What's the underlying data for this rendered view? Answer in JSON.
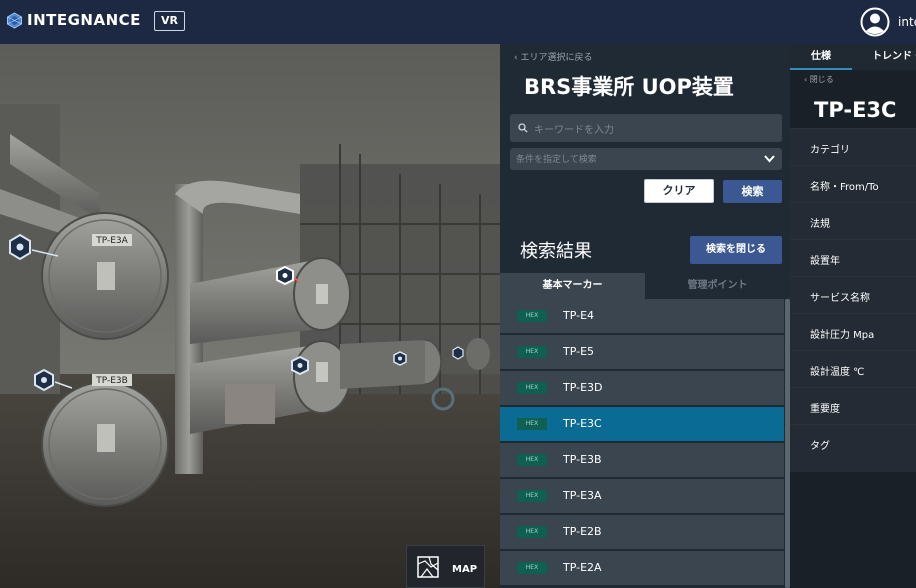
{
  "header": {
    "brand": "INTEGNANCE",
    "vr_label": "VR",
    "user_name": "inte"
  },
  "viewer": {
    "tag_labels": [
      "TP-E3A",
      "TP-E3B"
    ],
    "map_label": "MAP"
  },
  "search_panel": {
    "back_label": "エリア選択に戻る",
    "title": "BRS事業所 UOP装置",
    "keyword_placeholder": "キーワードを入力",
    "condition_placeholder": "条件を指定して検索",
    "clear_label": "クリア",
    "search_label": "検索",
    "results_title": "検索結果",
    "close_results_label": "検索を閉じる",
    "tabs": [
      {
        "label": "基本マーカー",
        "active": true
      },
      {
        "label": "管理ポイント",
        "active": false
      }
    ],
    "results": [
      {
        "badge": "HEX",
        "label": "TP-E4",
        "selected": false
      },
      {
        "badge": "HEX",
        "label": "TP-E5",
        "selected": false
      },
      {
        "badge": "HEX",
        "label": "TP-E3D",
        "selected": false
      },
      {
        "badge": "HEX",
        "label": "TP-E3C",
        "selected": true
      },
      {
        "badge": "HEX",
        "label": "TP-E3B",
        "selected": false
      },
      {
        "badge": "HEX",
        "label": "TP-E3A",
        "selected": false
      },
      {
        "badge": "HEX",
        "label": "TP-E2B",
        "selected": false
      },
      {
        "badge": "HEX",
        "label": "TP-E2A",
        "selected": false
      }
    ]
  },
  "detail_panel": {
    "tabs": [
      "仕様",
      "トレンド・"
    ],
    "back_label": "閉じる",
    "title": "TP-E3C",
    "properties": [
      "カテゴリ",
      "名称・From/To",
      "法規",
      "設置年",
      "サービス名称",
      "設計圧力 Mpa",
      "設計温度 ℃",
      "重要度",
      "タグ"
    ]
  },
  "colors": {
    "header_bg": "#1d2942",
    "panel_bg": "#1f2a35",
    "row_bg": "#3a4550",
    "selected_row": "#0a6b94",
    "button_primary": "#3b5892",
    "hex_badge": "#0f5f52"
  }
}
